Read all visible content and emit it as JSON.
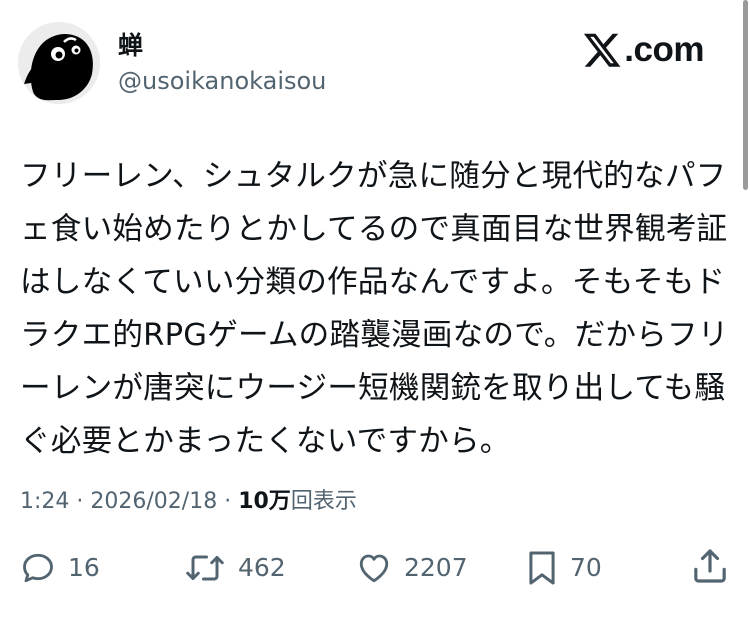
{
  "tweet": {
    "author": {
      "display_name": "蝉",
      "handle": "@usoikanokaisou"
    },
    "brand": {
      "text": "com"
    },
    "text_lines": [
      "フリーレン、シュタルクが急に随分と現代的なパフ",
      "ェ食い始めたりとかしてるので真面目な世界観考証",
      "はしなくていい分類の作品なんですよ。そもそもド",
      "ラクエ的RPGゲームの踏襲漫画なので。だからフリ",
      "ーレンが唐突にウージー短機関銃を取り出しても騒",
      "ぐ必要とかまったくないですから。"
    ],
    "meta": {
      "time": "1:24",
      "separator": " · ",
      "date": "2026/02/18",
      "views_number": "10万",
      "views_label": "回表示"
    },
    "stats": {
      "replies": "16",
      "reposts": "462",
      "likes": "2207",
      "bookmarks": "70"
    }
  },
  "icons": {
    "avatar": "ghost-avatar",
    "brand": "x-logo",
    "reply": "speech-bubble-icon",
    "repost": "repost-arrows-icon",
    "like": "heart-icon",
    "bookmark": "bookmark-icon",
    "share": "share-upload-icon"
  },
  "colors": {
    "text": "#0f1419",
    "secondary": "#536471",
    "background": "#ffffff"
  }
}
